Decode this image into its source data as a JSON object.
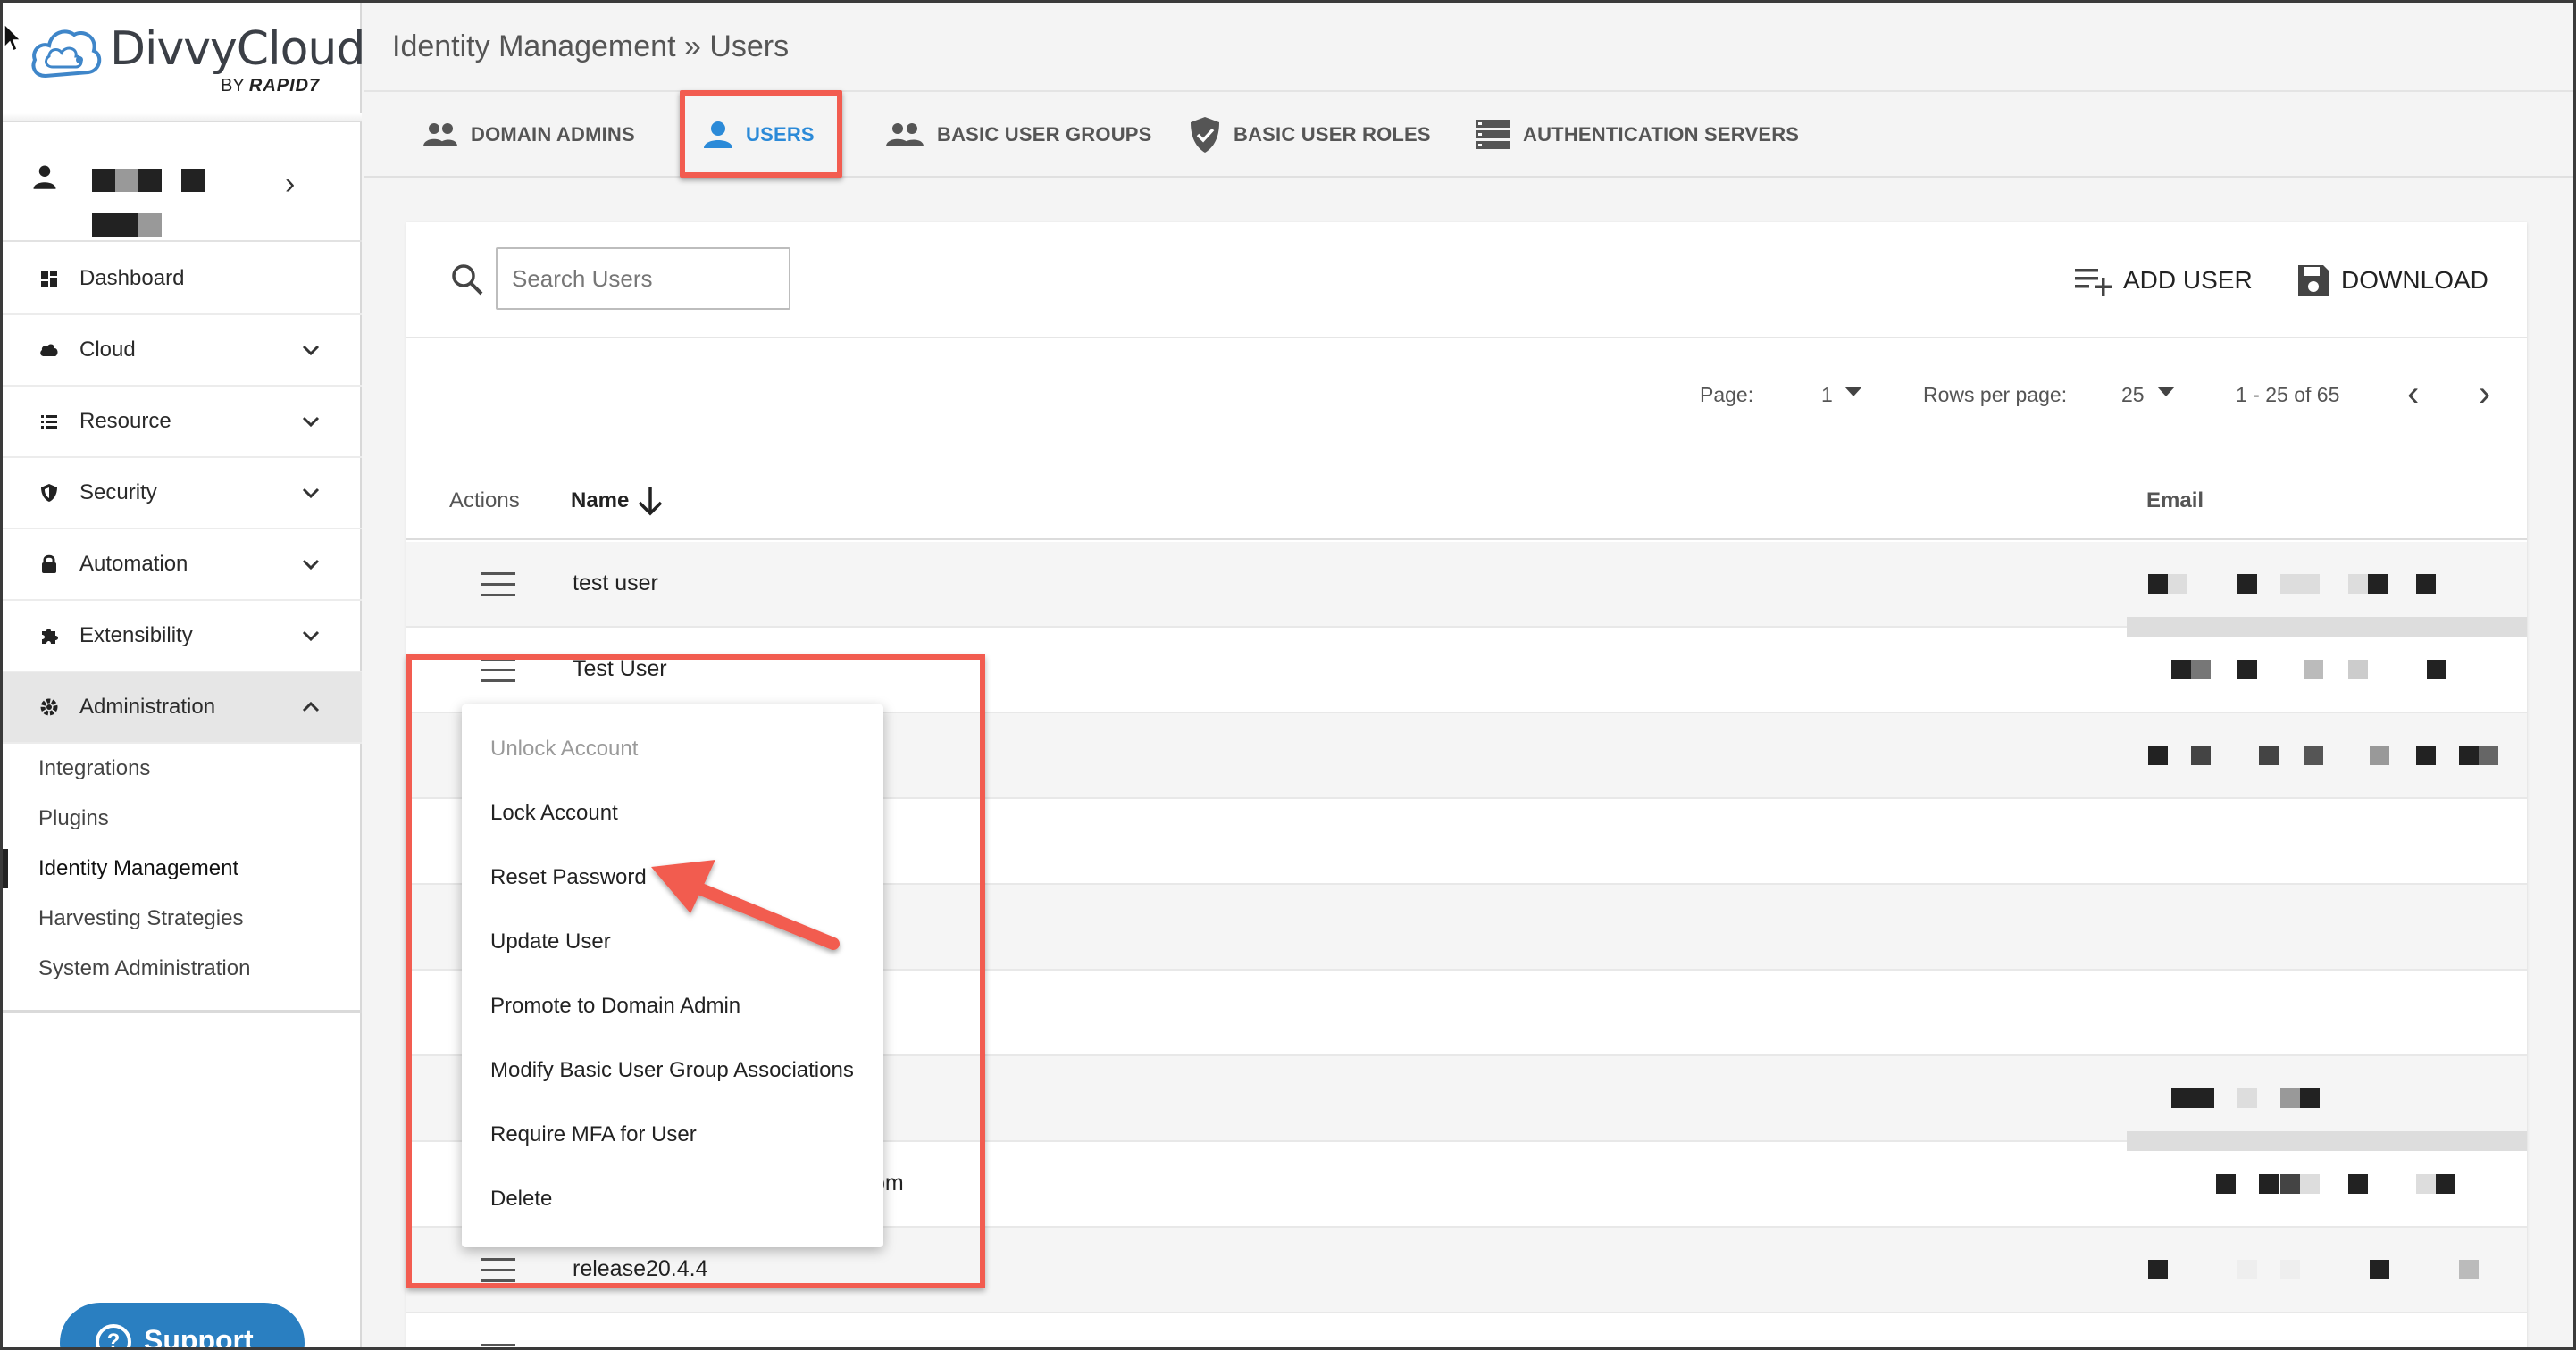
{
  "app": {
    "brand_name": "DivvyCloud",
    "brand_by": "BY",
    "brand_company": "RAPID7"
  },
  "breadcrumb": "Identity Management » Users",
  "sidebar": {
    "items": [
      {
        "label": "Dashboard",
        "icon": "dashboard-icon"
      },
      {
        "label": "Cloud",
        "icon": "cloud-icon"
      },
      {
        "label": "Resource",
        "icon": "list-icon"
      },
      {
        "label": "Security",
        "icon": "shield-icon"
      },
      {
        "label": "Automation",
        "icon": "lock-icon"
      },
      {
        "label": "Extensibility",
        "icon": "puzzle-icon"
      },
      {
        "label": "Administration",
        "icon": "gear-icon"
      }
    ],
    "sub_items": [
      {
        "label": "Integrations"
      },
      {
        "label": "Plugins"
      },
      {
        "label": "Identity Management"
      },
      {
        "label": "Harvesting Strategies"
      },
      {
        "label": "System Administration"
      }
    ],
    "support_label": "Support"
  },
  "tabs": [
    {
      "label": "DOMAIN ADMINS",
      "icon": "people-icon"
    },
    {
      "label": "USERS",
      "icon": "person-icon"
    },
    {
      "label": "BASIC USER GROUPS",
      "icon": "people-icon"
    },
    {
      "label": "BASIC USER ROLES",
      "icon": "shield-check-icon"
    },
    {
      "label": "AUTHENTICATION SERVERS",
      "icon": "server-icon"
    }
  ],
  "toolbar": {
    "search_placeholder": "Search Users",
    "add_user_label": "ADD USER",
    "download_label": "DOWNLOAD"
  },
  "pager": {
    "page_label": "Page:",
    "page_value": "1",
    "rows_label": "Rows per page:",
    "rows_value": "25",
    "range": "1 - 25 of 65"
  },
  "table": {
    "headers": {
      "actions": "Actions",
      "name": "Name",
      "email": "Email"
    },
    "rows": [
      {
        "name": "test user"
      },
      {
        "name": "Test User"
      },
      {
        "name": ""
      },
      {
        "name": ""
      },
      {
        "name": ""
      },
      {
        "name": ""
      },
      {
        "name": ""
      },
      {
        "name": "om"
      },
      {
        "name": "release20.4.4"
      },
      {
        "name": ""
      }
    ]
  },
  "context_menu": {
    "items": [
      {
        "label": "Unlock Account",
        "disabled": true
      },
      {
        "label": "Lock Account"
      },
      {
        "label": "Reset Password"
      },
      {
        "label": "Update User"
      },
      {
        "label": "Promote to Domain Admin"
      },
      {
        "label": "Modify Basic User Group Associations"
      },
      {
        "label": "Require MFA for User"
      },
      {
        "label": "Delete"
      }
    ]
  },
  "colors": {
    "accent": "#2b8ad8",
    "highlight": "#f25c50",
    "support": "#2a7fc1"
  }
}
